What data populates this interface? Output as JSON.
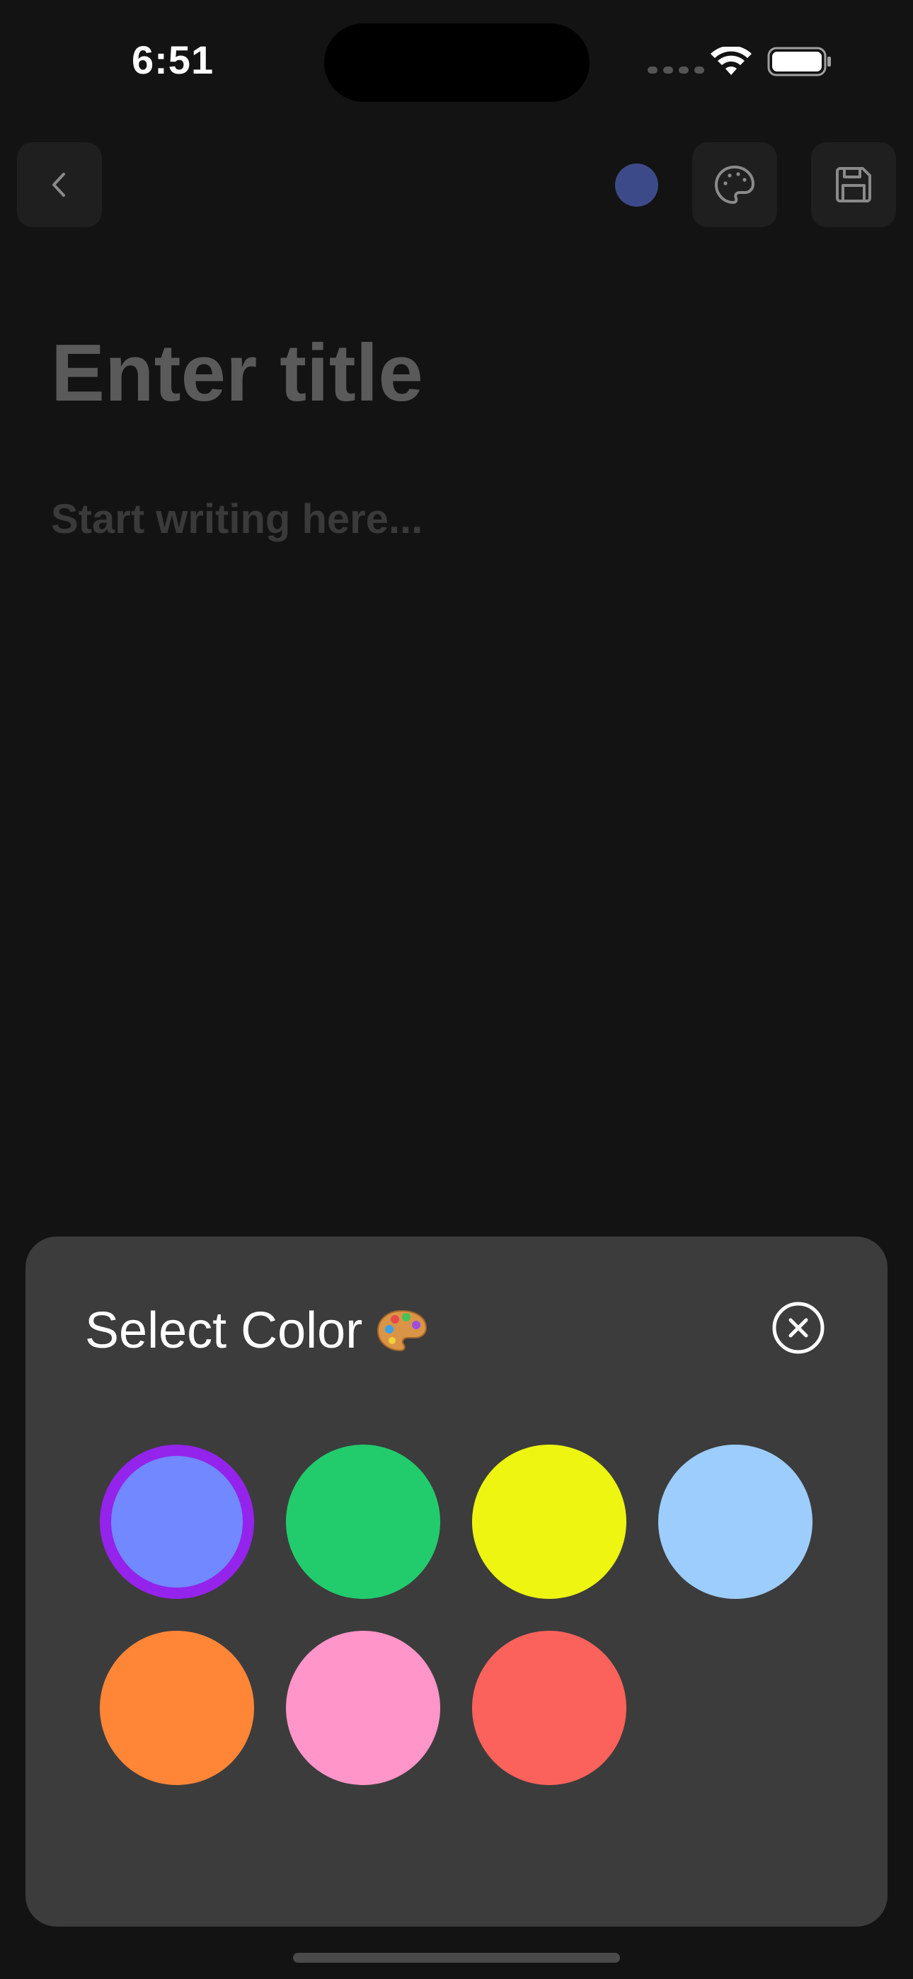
{
  "status_bar": {
    "time": "6:51"
  },
  "toolbar": {
    "back_icon": "chevron-left-icon",
    "current_color": "#3d4a8a",
    "palette_icon": "palette-icon",
    "save_icon": "save-icon"
  },
  "editor": {
    "title_value": "",
    "title_placeholder": "Enter title",
    "body_value": "",
    "body_placeholder": "Start writing here..."
  },
  "color_sheet": {
    "title": "Select Color",
    "title_icon": "palette-emoji-icon",
    "close_icon": "close-circle-icon",
    "colors": [
      {
        "hex": "#7188ff",
        "selected": true
      },
      {
        "hex": "#22cc6d",
        "selected": false
      },
      {
        "hex": "#edf510",
        "selected": false
      },
      {
        "hex": "#9ccdfd",
        "selected": false
      },
      {
        "hex": "#ff8537",
        "selected": false
      },
      {
        "hex": "#ff95c8",
        "selected": false
      },
      {
        "hex": "#fa625b",
        "selected": false
      }
    ],
    "selected_border_color": "#9423ec"
  }
}
